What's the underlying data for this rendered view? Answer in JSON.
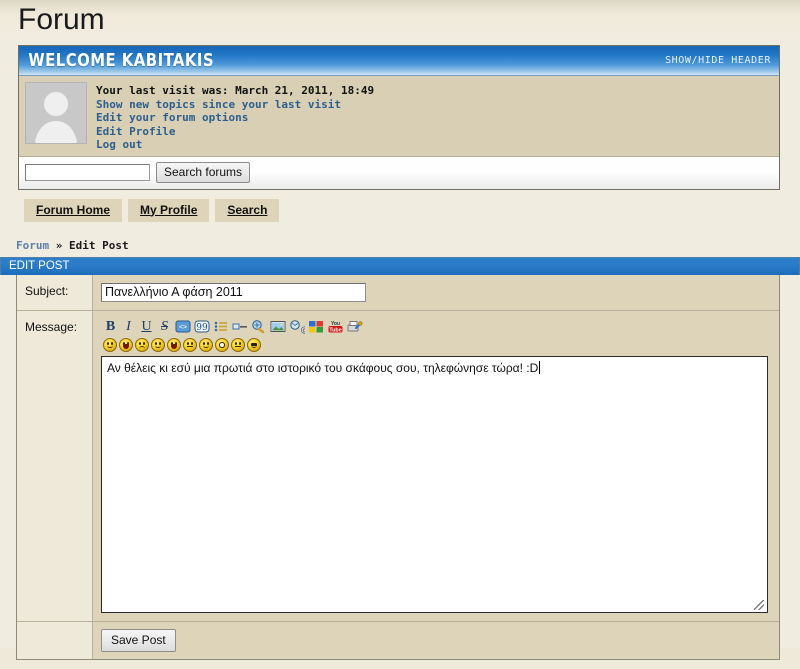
{
  "page": {
    "title": "Forum"
  },
  "welcome": {
    "title": "WELCOME KABITAKIS",
    "show_hide": "SHOW/HIDE HEADER",
    "last_visit": "Your last visit was: March 21, 2011, 18:49",
    "links": [
      "Show new topics since your last visit",
      "Edit your forum options",
      "Edit Profile",
      "Log out"
    ],
    "search": {
      "value": "",
      "placeholder": "",
      "button": "Search forums"
    }
  },
  "nav": {
    "items": [
      "Forum Home",
      "My Profile",
      "Search"
    ]
  },
  "breadcrumb": {
    "root": "Forum",
    "separator": "»",
    "current": "Edit Post"
  },
  "edit_post": {
    "panel_title": "EDIT POST",
    "subject_label": "Subject:",
    "subject_value": "Πανελλήνιο Α φάση 2011",
    "message_label": "Message:",
    "message_value": "Αν θέλεις κι εσύ μια πρωτιά στο ιστορικό του σκάφους σου, τηλεφώνησε τώρα! :D",
    "save_label": "Save Post",
    "toolbar": [
      {
        "name": "bold-icon",
        "glyph": "B"
      },
      {
        "name": "italic-icon",
        "glyph": "I"
      },
      {
        "name": "underline-icon",
        "glyph": "U"
      },
      {
        "name": "strikethrough-icon",
        "glyph": "S"
      },
      {
        "name": "code-icon",
        "glyph": ""
      },
      {
        "name": "quote-icon",
        "glyph": ""
      },
      {
        "name": "bullet-list-icon",
        "glyph": ""
      },
      {
        "name": "horizontal-rule-icon",
        "glyph": ""
      },
      {
        "name": "link-icon",
        "glyph": ""
      },
      {
        "name": "image-icon",
        "glyph": ""
      },
      {
        "name": "email-icon",
        "glyph": ""
      },
      {
        "name": "font-color-icon",
        "glyph": ""
      },
      {
        "name": "youtube-icon",
        "glyph": "You"
      },
      {
        "name": "attachment-icon",
        "glyph": ""
      }
    ],
    "emoticons": [
      "smile",
      "grin",
      "sad",
      "wink",
      "laugh",
      "tongue",
      "happy",
      "shocked",
      "confused",
      "cool"
    ]
  },
  "colors": {
    "page_bg": "#f1ece0",
    "panel_bg": "#ddd4ba",
    "header_blue": "#1766b8",
    "panel_title_blue": "#2d7fcc",
    "link_blue": "#2d5f8e"
  }
}
